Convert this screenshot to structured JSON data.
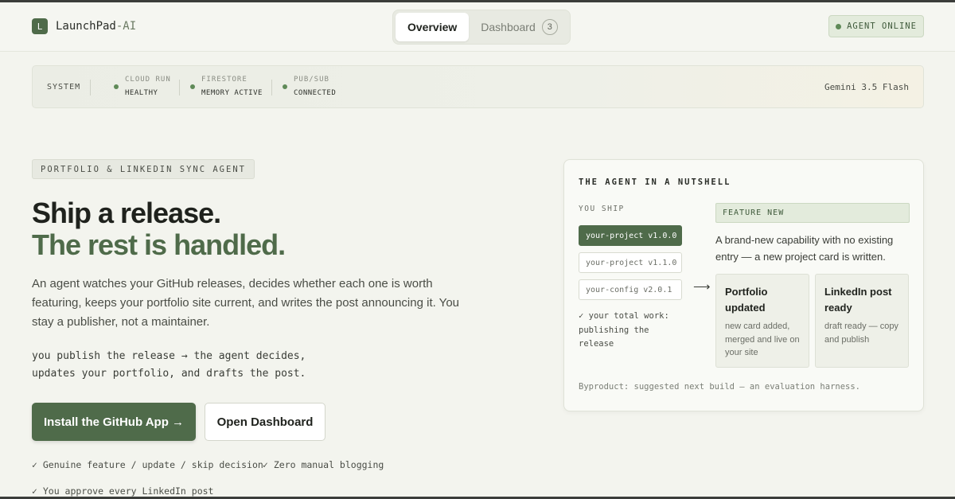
{
  "brand": {
    "mark": "L",
    "name": "LaunchPad",
    "suffix": "-AI"
  },
  "nav": {
    "tabs": [
      {
        "label": "Overview",
        "active": true
      },
      {
        "label": "Dashboard",
        "count": "3",
        "active": false
      }
    ]
  },
  "status": {
    "agent": "AGENT ONLINE"
  },
  "system": {
    "label": "SYSTEM",
    "items": [
      {
        "name": "CLOUD RUN",
        "value": "HEALTHY"
      },
      {
        "name": "FIRESTORE",
        "value": "MEMORY ACTIVE"
      },
      {
        "name": "PUB/SUB",
        "value": "CONNECTED"
      }
    ],
    "model": "Gemini 3.5 Flash"
  },
  "hero": {
    "eyebrow": "PORTFOLIO & LINKEDIN SYNC AGENT",
    "headline_line1": "Ship a release.",
    "headline_line2": "The rest is handled.",
    "lede": "An agent watches your GitHub releases, decides whether each one is worth featuring, keeps your portfolio site current, and writes the post announcing it. You stay a publisher, not a maintainer.",
    "flow_line1": "you publish the release → the agent decides,",
    "flow_line2": "updates your portfolio, and drafts the post.",
    "primary_cta": "Install the GitHub App →",
    "secondary_cta": "Open Dashboard",
    "checks": [
      "✓ Genuine feature / update / skip decision",
      "✓ Zero manual blogging",
      "✓ You approve every LinkedIn post"
    ]
  },
  "nutshell": {
    "title": "THE AGENT IN A NUTSHELL",
    "ship_label": "YOU SHIP",
    "releases": [
      "your-project v1.0.0",
      "your-project v1.1.0",
      "your-config v2.0.1"
    ],
    "total_work": "✓ your total work: publishing the release",
    "arrow": "⟶",
    "verdict": "FEATURE NEW",
    "verdict_desc": "A brand-new capability with no existing entry — a new project card is written.",
    "results": [
      {
        "title": "Portfolio updated",
        "desc": "new card added, merged and live on your site"
      },
      {
        "title": "LinkedIn post ready",
        "desc": "draft ready — copy and publish"
      }
    ],
    "byproduct": "Byproduct: suggested next build — an evaluation harness."
  },
  "colors": {
    "accent": "#4f6b4a",
    "background": "#f3f4ee",
    "success": "#5f8a58"
  }
}
